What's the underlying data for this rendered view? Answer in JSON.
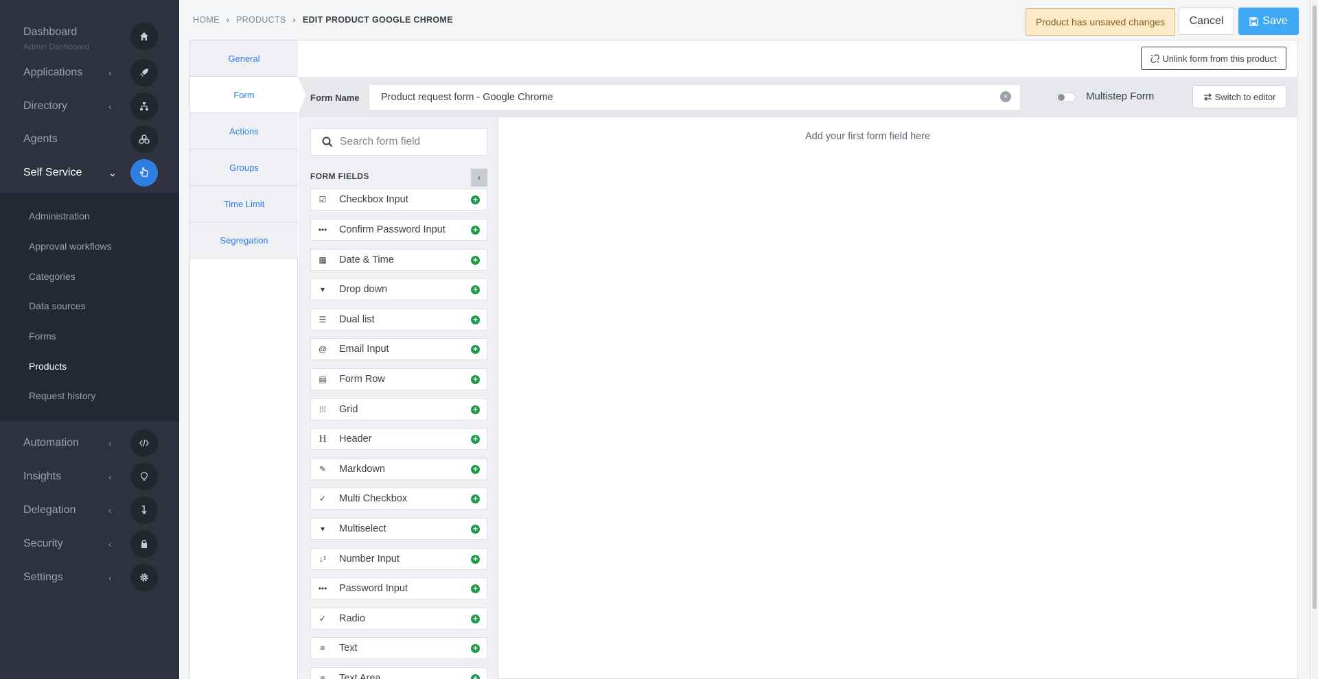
{
  "sidebar": {
    "dashboard": {
      "label": "Dashboard",
      "sublabel": "Admin Dashboard",
      "icon": "home-icon"
    },
    "items": [
      {
        "label": "Applications",
        "icon": "rocket-icon"
      },
      {
        "label": "Directory",
        "icon": "sitemap-icon"
      },
      {
        "label": "Agents",
        "icon": "agents-icon"
      },
      {
        "label": "Self Service",
        "icon": "hand-pointer-icon"
      },
      {
        "label": "Automation",
        "icon": "code-icon"
      },
      {
        "label": "Insights",
        "icon": "lightbulb-icon"
      },
      {
        "label": "Delegation",
        "icon": "delegation-icon"
      },
      {
        "label": "Security",
        "icon": "lock-icon"
      },
      {
        "label": "Settings",
        "icon": "gear-icon"
      }
    ],
    "submenu": [
      "Administration",
      "Approval workflows",
      "Categories",
      "Data sources",
      "Forms",
      "Products",
      "Request history"
    ],
    "submenu_current": "Products",
    "accent_color": "#2f7fe0"
  },
  "header": {
    "breadcrumb": [
      "HOME",
      "PRODUCTS",
      "EDIT PRODUCT GOOGLE CHROME"
    ],
    "unsaved": "Product has unsaved changes",
    "cancel": "Cancel",
    "save": "Save"
  },
  "tabs": [
    "General",
    "Form",
    "Actions",
    "Groups",
    "Time Limit",
    "Segregation"
  ],
  "active_tab": "Form",
  "form": {
    "unlink_label": "Unlink form from this product",
    "name_label": "Form Name",
    "name_value": "Product request form - Google Chrome",
    "multistep_label": "Multistep Form",
    "multistep_on": false,
    "switch_label": "Switch to editor",
    "empty_message": "Add your first form field here"
  },
  "fields_panel": {
    "search_placeholder": "Search form field",
    "title": "FORM FIELDS",
    "fields": [
      {
        "label": "Checkbox Input",
        "icon": "checkbox-icon"
      },
      {
        "label": "Confirm Password Input",
        "icon": "password-dots-icon"
      },
      {
        "label": "Date & Time",
        "icon": "calendar-icon"
      },
      {
        "label": "Drop down",
        "icon": "dropdown-icon"
      },
      {
        "label": "Dual list",
        "icon": "list-icon"
      },
      {
        "label": "Email Input",
        "icon": "at-icon"
      },
      {
        "label": "Form Row",
        "icon": "table-icon"
      },
      {
        "label": "Grid",
        "icon": "grid-icon"
      },
      {
        "label": "Header",
        "icon": "heading-icon"
      },
      {
        "label": "Markdown",
        "icon": "edit-icon"
      },
      {
        "label": "Multi Checkbox",
        "icon": "check-circle-icon"
      },
      {
        "label": "Multiselect",
        "icon": "dropdown-icon"
      },
      {
        "label": "Number Input",
        "icon": "sort-numeric-icon"
      },
      {
        "label": "Password Input",
        "icon": "password-dots-icon"
      },
      {
        "label": "Radio",
        "icon": "check-circle-icon"
      },
      {
        "label": "Text",
        "icon": "align-left-icon"
      },
      {
        "label": "Text Area",
        "icon": "align-left-icon"
      }
    ]
  }
}
